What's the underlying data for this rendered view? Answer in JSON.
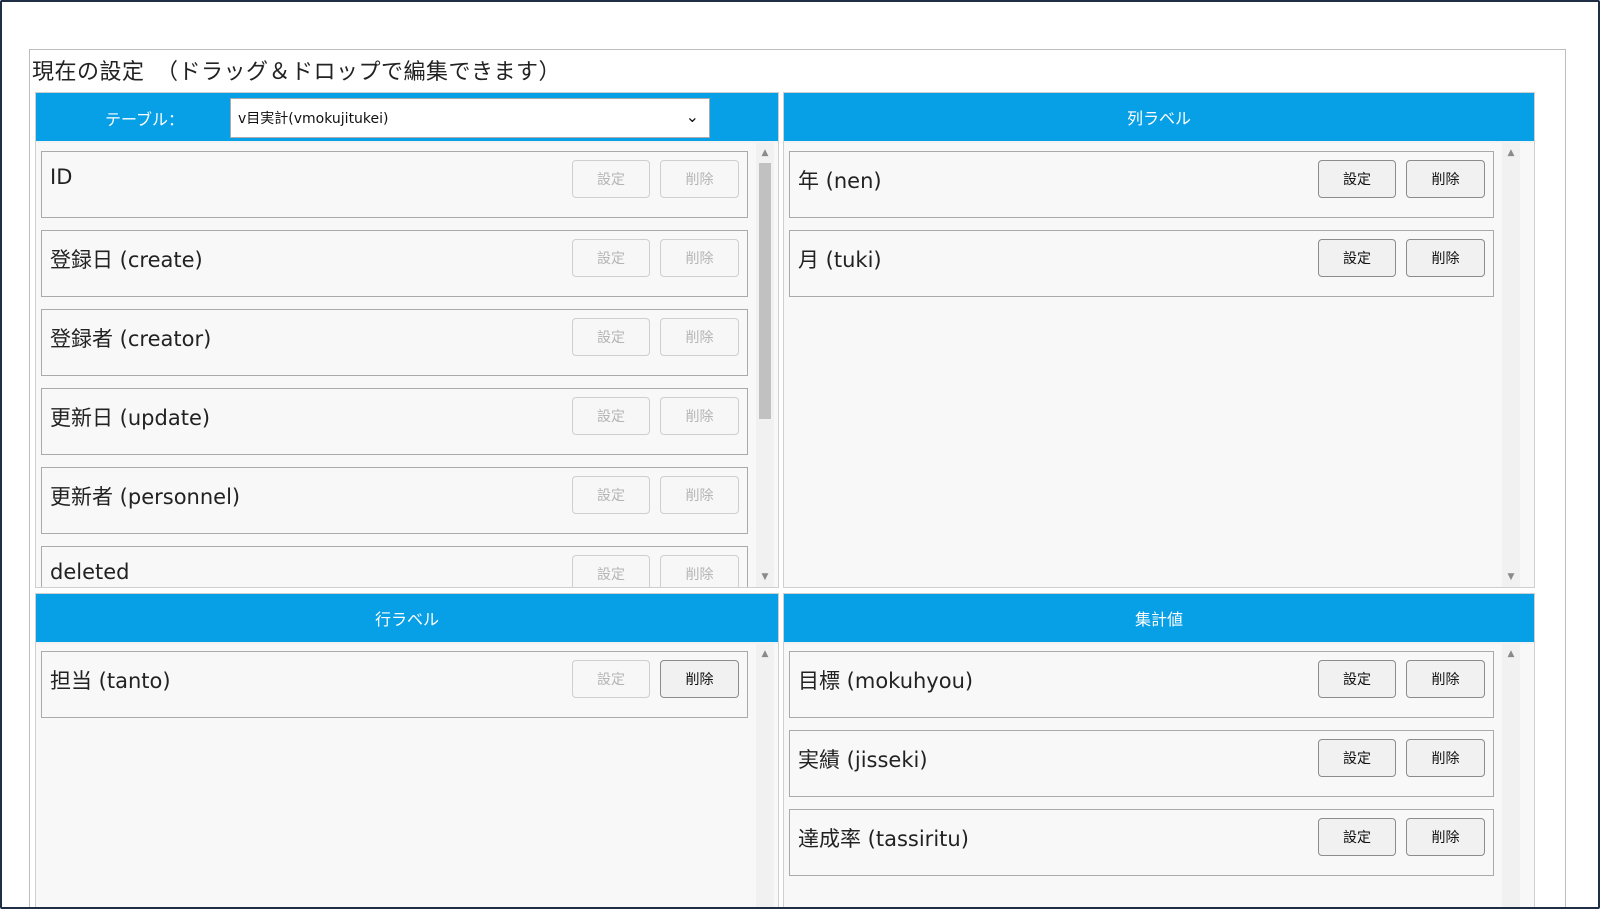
{
  "heading": "現在の設定　（ドラッグ＆ドロップで編集できます）",
  "table_panel": {
    "label": "テーブル：",
    "selected_table": "v目実計(vmokujitukei)",
    "fields": [
      {
        "name": "ID",
        "set": "設定",
        "delete": "削除"
      },
      {
        "name": "登録日 (create)",
        "set": "設定",
        "delete": "削除"
      },
      {
        "name": "登録者 (creator)",
        "set": "設定",
        "delete": "削除"
      },
      {
        "name": "更新日 (update)",
        "set": "設定",
        "delete": "削除"
      },
      {
        "name": "更新者 (personnel)",
        "set": "設定",
        "delete": "削除"
      },
      {
        "name": "deleted",
        "set": "設定",
        "delete": "削除"
      }
    ]
  },
  "column_panel": {
    "title": "列ラベル",
    "fields": [
      {
        "name": "年 (nen)",
        "set": "設定",
        "delete": "削除"
      },
      {
        "name": "月 (tuki)",
        "set": "設定",
        "delete": "削除"
      }
    ]
  },
  "row_panel": {
    "title": "行ラベル",
    "fields": [
      {
        "name": "担当 (tanto)",
        "set": "設定",
        "delete": "削除"
      }
    ]
  },
  "value_panel": {
    "title": "集計値",
    "fields": [
      {
        "name": "目標 (mokuhyou)",
        "set": "設定",
        "delete": "削除"
      },
      {
        "name": "実績 (jisseki)",
        "set": "設定",
        "delete": "削除"
      },
      {
        "name": "達成率 (tassiritu)",
        "set": "設定",
        "delete": "削除"
      }
    ]
  },
  "colors": {
    "header_blue": "#079fe6",
    "frame_border": "#1f2d45"
  },
  "icons": {
    "select_arrow": "chevron-down-icon",
    "scroll_up": "scroll-up-arrow-icon",
    "scroll_down": "scroll-down-arrow-icon"
  }
}
